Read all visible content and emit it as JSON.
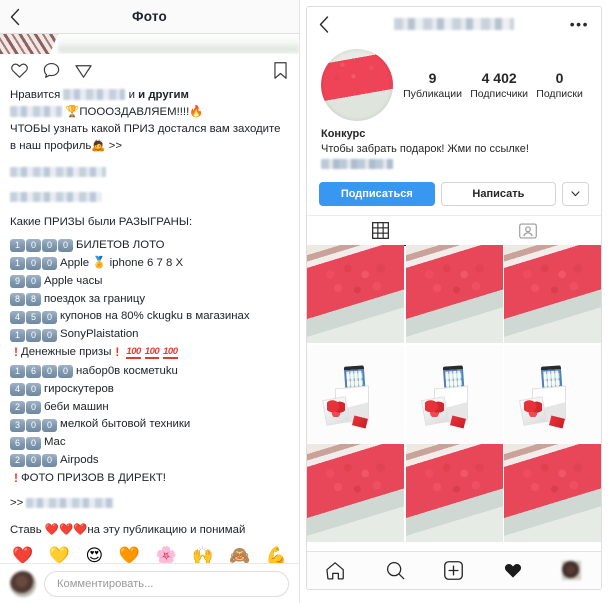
{
  "post": {
    "nav": {
      "title": "Фото",
      "back_icon": "chevron-left-icon"
    },
    "actions": {
      "like_icon": "heart-outline-icon",
      "comment_icon": "comment-bubble-icon",
      "share_icon": "paper-plane-icon",
      "save_icon": "bookmark-outline-icon"
    },
    "likes_prefix": "Нравится",
    "likes_suffix": "и другим",
    "caption": {
      "line1_emoji": "🏆",
      "line1_text": "ПОООЗДАВЛЯЕМ!!!!",
      "line1_emoji2": "🔥",
      "line2": "ЧТОБЫ узнать какой ПРИЗ достался вам заходите",
      "line3": "в наш профиль",
      "line3_emoji": "🙇",
      "line3_tail": ">>"
    },
    "prizes_heading": "Какие ПРИЗЫ были РАЗЫГРАНЫ:",
    "prizes": [
      {
        "digits": [
          "1",
          "0",
          "0",
          "0"
        ],
        "label": "БИЛЕТОВ ЛОТО"
      },
      {
        "digits": [
          "1",
          "0",
          "0"
        ],
        "label": "Apple 🏅 iphone 6 7 8 X"
      },
      {
        "digits": [
          "9",
          "0"
        ],
        "label": "Apple часы"
      },
      {
        "digits": [
          "8",
          "8"
        ],
        "label": "поездок за границу"
      },
      {
        "digits": [
          "4",
          "5",
          "0"
        ],
        "label": "купонов на 80% ckugku в магазинах"
      },
      {
        "digits": [
          "1",
          "0",
          "0"
        ],
        "label": "SonyPlaistation"
      }
    ],
    "money_line": {
      "bang": "❗",
      "text": "Денежные призы",
      "bang2": "❗",
      "hundreds": [
        "100",
        "100",
        "100"
      ]
    },
    "prizes2": [
      {
        "digits": [
          "1",
          "6",
          "0",
          "0"
        ],
        "label": "набор0в косметuku"
      },
      {
        "digits": [
          "4",
          "0"
        ],
        "label": "гироскутеров"
      },
      {
        "digits": [
          "2",
          "0"
        ],
        "label": "беби машин"
      },
      {
        "digits": [
          "3",
          "0",
          "0"
        ],
        "label": "мелкой бытовой техники"
      },
      {
        "digits": [
          "6",
          "0"
        ],
        "label": "Mac"
      },
      {
        "digits": [
          "2",
          "0",
          "0"
        ],
        "label": "Airpods"
      }
    ],
    "direct_line": {
      "bang": "❗",
      "text": "ФОТО ПРИЗОВ В ДИРЕКТ!"
    },
    "link_arrow": ">>",
    "cta_line": {
      "prefix": "Ставь",
      "hearts": "❤️❤️❤️",
      "suffix": "на эту публикацию и понимай"
    },
    "emoji_row": [
      "❤️",
      "💛",
      "😍",
      "🧡",
      "🌸",
      "🙌",
      "🙈",
      "💪"
    ],
    "comment_bar": {
      "placeholder": "Комментировать...",
      "avatar": "user-avatar"
    }
  },
  "profile": {
    "nav": {
      "back_icon": "chevron-left-icon",
      "menu_icon": "more-options-icon",
      "username": ""
    },
    "avatar": "profile-avatar-roses",
    "stats": [
      {
        "value": "9",
        "label": "Публикации"
      },
      {
        "value": "4 402",
        "label": "Подписчики"
      },
      {
        "value": "0",
        "label": "Подписки"
      }
    ],
    "bio": {
      "name": "Конкурс",
      "text": "Чтобы забрать подарок! Жми по ссылке!"
    },
    "buttons": {
      "follow": "Подписаться",
      "message": "Написать",
      "more_icon": "chevron-down-icon"
    },
    "tabs": [
      {
        "icon": "grid-icon",
        "active": true
      },
      {
        "icon": "tagged-person-icon",
        "active": false
      }
    ],
    "grid": [
      "roses",
      "roses",
      "roses",
      "phone",
      "phone",
      "phone",
      "roses",
      "roses",
      "roses"
    ],
    "bottom_nav": [
      {
        "icon": "home-icon"
      },
      {
        "icon": "search-icon"
      },
      {
        "icon": "add-post-icon"
      },
      {
        "icon": "heart-filled-icon"
      },
      {
        "icon": "profile-avatar-icon"
      }
    ]
  },
  "colors": {
    "accent_blue": "#3897f0",
    "text_dark": "#262626",
    "red": "#e23b2e",
    "tile_blue": "#7f97ae"
  }
}
